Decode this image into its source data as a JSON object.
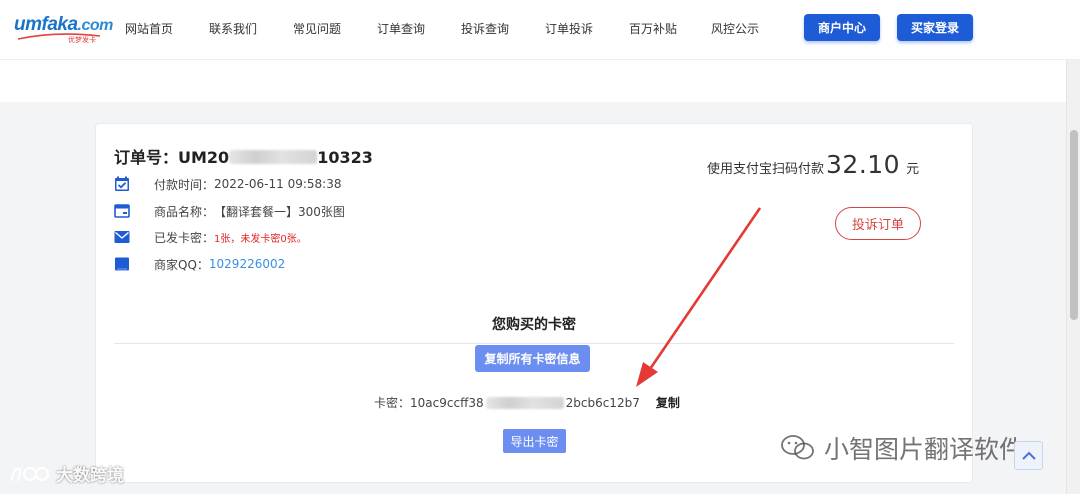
{
  "brand": {
    "logo_main": "umfaka",
    "logo_domain": ".com",
    "logo_sub": "优梦发卡"
  },
  "nav": {
    "items": [
      "网站首页",
      "联系我们",
      "常见问题",
      "订单查询",
      "投诉查询",
      "订单投诉",
      "百万补贴",
      "风控公示"
    ],
    "merchant_btn": "商户中心",
    "buyer_btn": "买家登录"
  },
  "order": {
    "number_prefix": "订单号：UM20",
    "number_suffix": "10323",
    "pay_time_label": "付款时间：",
    "pay_time": "2022-06-11 09:58:38",
    "product_label": "商品名称：",
    "product": "【翻译套餐一】300张图",
    "sent_label": "已发卡密：",
    "sent_value": "1张，未发卡密0张。",
    "qq_label": "商家QQ：",
    "qq": "1029226002",
    "pay_prefix": "使用支付宝扫码付款",
    "amount": "32.10",
    "unit": "元",
    "complain_btn": "投诉订单"
  },
  "cards": {
    "title": "您购买的卡密",
    "copy_all_btn": "复制所有卡密信息",
    "key_label": "卡密：",
    "key_prefix": "10ac9ccff38",
    "key_suffix": "2bcb6c12b7",
    "copy_link": "复制",
    "export_btn": "导出卡密"
  },
  "watermarks": {
    "right": "小智图片翻译软件",
    "left": "大数跨境"
  },
  "colors": {
    "primary": "#1e5bd6",
    "button_light": "#6c8ef0",
    "danger": "#d64545",
    "link": "#3a8ee6",
    "arrow": "#e53935"
  }
}
